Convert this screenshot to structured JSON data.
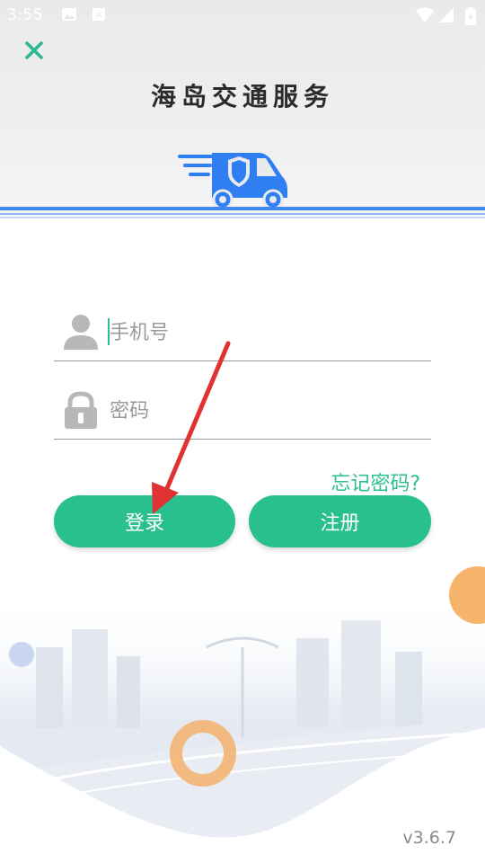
{
  "status_bar": {
    "time": "3:55"
  },
  "header": {
    "title": "海岛交通服务"
  },
  "form": {
    "phone_placeholder": "手机号",
    "password_placeholder": "密码",
    "forgot_password": "忘记密码?",
    "login_label": "登录",
    "register_label": "注册"
  },
  "footer": {
    "version": "v3.6.7"
  },
  "colors": {
    "accent": "#2abf8e",
    "logo_blue": "#2f7ff2",
    "orange": "#f5b36b"
  },
  "icons": [
    "close-icon",
    "truck-logo-icon",
    "user-icon",
    "lock-icon",
    "wifi-icon",
    "signal-icon",
    "battery-icon",
    "image-icon",
    "keyboard-icon"
  ]
}
